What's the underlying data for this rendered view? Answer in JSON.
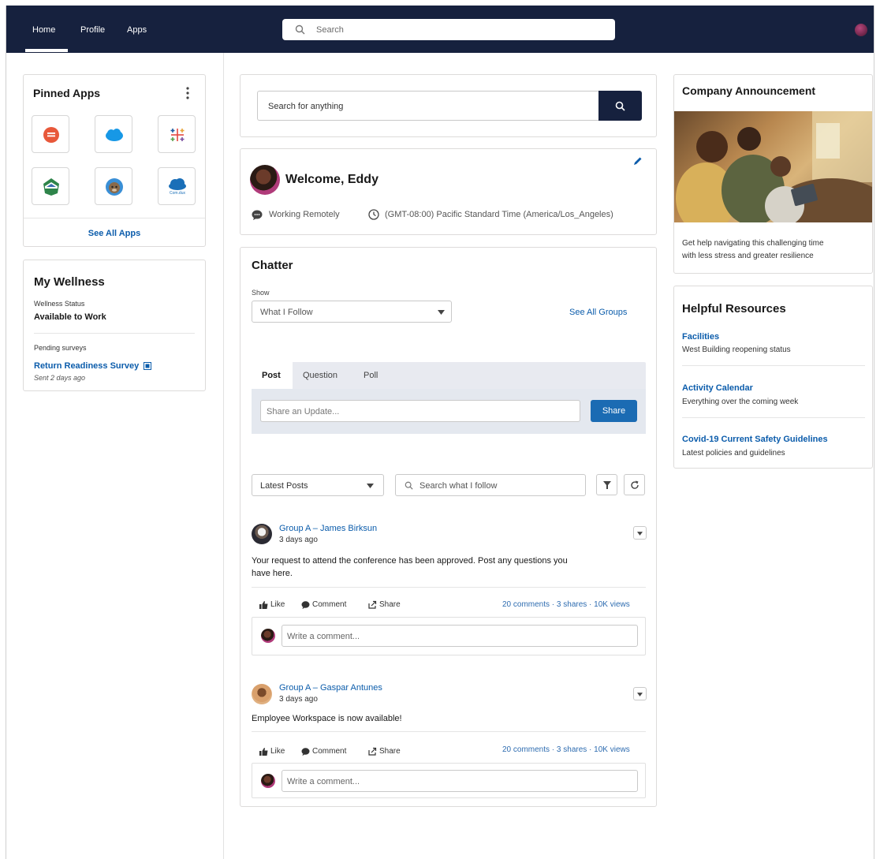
{
  "nav": {
    "items": [
      "Home",
      "Profile",
      "Apps"
    ],
    "search_placeholder": "Search"
  },
  "pinned_apps": {
    "title": "Pinned Apps",
    "see_all": "See All Apps",
    "apps": [
      {
        "icon": "chat-bubble-icon",
        "color": "#e8583a"
      },
      {
        "icon": "cloud-icon",
        "color": "#1798e6"
      },
      {
        "icon": "tableau-icon",
        "color": "#e5483f"
      },
      {
        "icon": "trailhead-badge-icon",
        "color": "#2e844a"
      },
      {
        "icon": "astro-icon",
        "color": "#3a8fd6"
      },
      {
        "icon": "com-dux-cloud-icon",
        "color": "#1a6fb8",
        "label": "Com.dux"
      }
    ]
  },
  "wellness": {
    "title": "My Wellness",
    "status_label": "Wellness Status",
    "status_value": "Available to Work",
    "pending_label": "Pending surveys",
    "survey_link": "Return Readiness Survey",
    "survey_sent": "Sent 2 days ago"
  },
  "main_search": {
    "placeholder": "Search for anything"
  },
  "welcome": {
    "title": "Welcome, Eddy",
    "location": "Working Remotely",
    "timezone": "(GMT-08:00) Pacific Standard Time (America/Los_Angeles)"
  },
  "chatter": {
    "title": "Chatter",
    "show_label": "Show",
    "show_value": "What I Follow",
    "see_all_groups": "See All Groups",
    "tabs": [
      "Post",
      "Question",
      "Poll"
    ],
    "share_placeholder": "Share an Update...",
    "share_button": "Share",
    "sort_value": "Latest Posts",
    "feed_search_placeholder": "Search what I follow",
    "posts": [
      {
        "author": "Group A – James Birksun",
        "time": "3 days ago",
        "body_line1": "Your request to attend the conference has been approved. Post any questions you",
        "body_line2": "have here.",
        "like": "Like",
        "comment": "Comment",
        "share": "Share",
        "stats": "20 comments · 3 shares · 10K views",
        "comment_placeholder": "Write a comment..."
      },
      {
        "author": "Group A – Gaspar Antunes",
        "time": "3 days ago",
        "body_line1": "Employee Workspace is now available!",
        "like": "Like",
        "comment": "Comment",
        "share": "Share",
        "stats": "20 comments · 3 shares · 10K views",
        "comment_placeholder": "Write a comment..."
      }
    ]
  },
  "announcement": {
    "title": "Company Announcement",
    "text_line1": "Get help navigating this challenging time",
    "text_line2": "with less stress and greater resilience"
  },
  "resources": {
    "title": "Helpful Resources",
    "items": [
      {
        "title": "Facilities",
        "desc": "West Building reopening status"
      },
      {
        "title": "Activity Calendar",
        "desc": "Everything over the coming week"
      },
      {
        "title": "Covid-19 Current Safety Guidelines",
        "desc": "Latest policies and guidelines"
      }
    ]
  }
}
